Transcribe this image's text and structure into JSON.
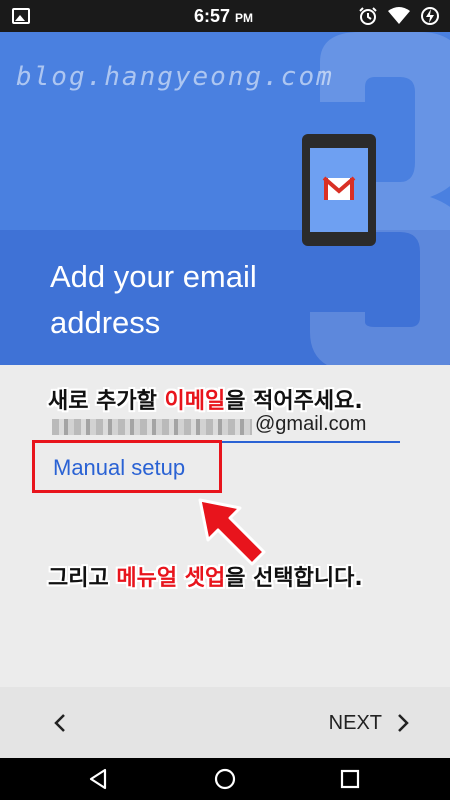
{
  "status_bar": {
    "time": "6:57",
    "ampm": "PM",
    "icons": [
      "gallery-icon",
      "alarm-icon",
      "wifi-icon",
      "battery-charging-icon"
    ]
  },
  "watermark": "blog.hangyeong.com",
  "hero": {
    "title": "Add your email address"
  },
  "instruction_1": {
    "before": "새로 추가할 ",
    "highlight": "이메일",
    "after": "을 적어주세요."
  },
  "email": {
    "suffix": "@gmail.com"
  },
  "manual_setup": {
    "label": "Manual setup"
  },
  "instruction_2": {
    "before": "그리고 ",
    "highlight": "메뉴얼 셋업",
    "after": "을 선택합니다."
  },
  "bottom_bar": {
    "back_icon": "chevron-left-icon",
    "next_label": "NEXT",
    "next_icon": "chevron-right-icon"
  },
  "system_nav": {
    "icons": [
      "back-triangle-icon",
      "home-circle-icon",
      "recents-square-icon"
    ]
  },
  "colors": {
    "hero_blue": "#4a80e0",
    "hero_band": "#3f72d6",
    "link_blue": "#2a62d4",
    "highlight_red": "#e8141c"
  }
}
